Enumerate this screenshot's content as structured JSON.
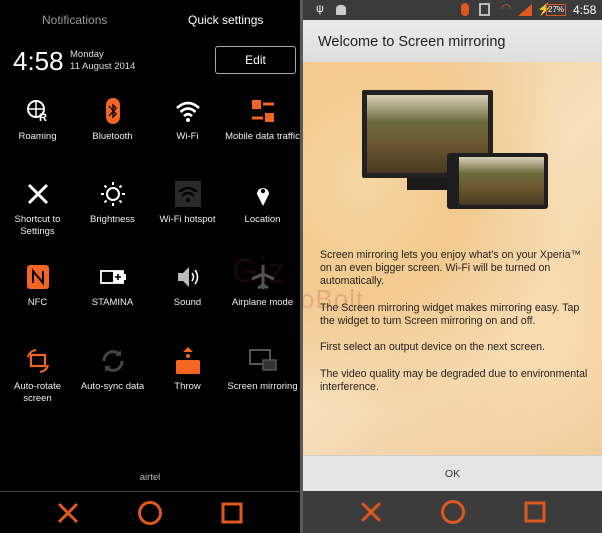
{
  "left": {
    "tabs": [
      "Notifications",
      "Quick settings"
    ],
    "time": "4:58",
    "day": "Monday",
    "date": "11 August 2014",
    "edit_label": "Edit",
    "tiles": [
      {
        "label": "Roaming",
        "icon": "globe-roaming-icon"
      },
      {
        "label": "Bluetooth",
        "icon": "bluetooth-icon"
      },
      {
        "label": "Wi-Fi",
        "icon": "wifi-icon"
      },
      {
        "label": "Mobile data traffic",
        "icon": "mobile-data-icon"
      },
      {
        "label": "Shortcut to Settings",
        "icon": "tools-icon"
      },
      {
        "label": "Brightness",
        "icon": "brightness-icon"
      },
      {
        "label": "Wi-Fi hotspot",
        "icon": "wifi-hotspot-icon"
      },
      {
        "label": "Location",
        "icon": "location-pin-icon"
      },
      {
        "label": "NFC",
        "icon": "nfc-icon"
      },
      {
        "label": "STAMINA",
        "icon": "battery-stamina-icon"
      },
      {
        "label": "Sound",
        "icon": "speaker-icon"
      },
      {
        "label": "Airplane mode",
        "icon": "airplane-icon"
      },
      {
        "label": "Auto-rotate screen",
        "icon": "auto-rotate-icon"
      },
      {
        "label": "Auto-sync data",
        "icon": "sync-icon"
      },
      {
        "label": "Throw",
        "icon": "throw-icon"
      },
      {
        "label": "Screen mirroring",
        "icon": "screen-mirroring-icon"
      }
    ],
    "carrier": "airtel"
  },
  "right": {
    "status": {
      "battery": "27%",
      "time": "4:58"
    },
    "title": "Welcome to Screen mirroring",
    "paragraphs": [
      "Screen mirroring lets you enjoy what's on your Xperia™ on an even bigger screen. Wi-Fi will be turned on automatically.",
      "The Screen mirroring widget makes mirroring easy. Tap the widget to turn Screen mirroring on and off.",
      "First select an output device on the next screen.",
      "The video quality may be degraded due to environmental interference."
    ],
    "ok_label": "OK"
  },
  "watermark": "GizmoBolt",
  "colors": {
    "accent": "#f26522",
    "active_icon": "#ffffff",
    "inactive_icon": "#555555"
  }
}
